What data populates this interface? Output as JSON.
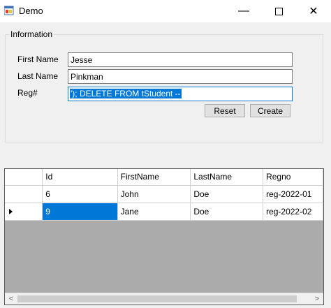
{
  "window": {
    "title": "Demo",
    "minimize_glyph": "—",
    "close_glyph": "✕"
  },
  "group": {
    "title": "Information"
  },
  "form": {
    "first_name_label": "First Name",
    "first_name_value": "Jesse",
    "last_name_label": "Last Name",
    "last_name_value": "Pinkman",
    "reg_label": "Reg#",
    "reg_value": "'); DELETE FROM tStudent --",
    "reset_label": "Reset",
    "create_label": "Create"
  },
  "grid": {
    "columns": [
      "Id",
      "FirstName",
      "LastName",
      "Regno"
    ],
    "rows": [
      {
        "id": "6",
        "first": "John",
        "last": "Doe",
        "regno": "reg-2022-01"
      },
      {
        "id": "9",
        "first": "Jane",
        "last": "Doe",
        "regno": "reg-2022-02"
      }
    ],
    "current_row_index": 1,
    "selected_cell": "Id",
    "scroll_left": "<",
    "scroll_right": ">"
  },
  "colors": {
    "selection": "#0078d7",
    "grid_background": "#ababab"
  }
}
